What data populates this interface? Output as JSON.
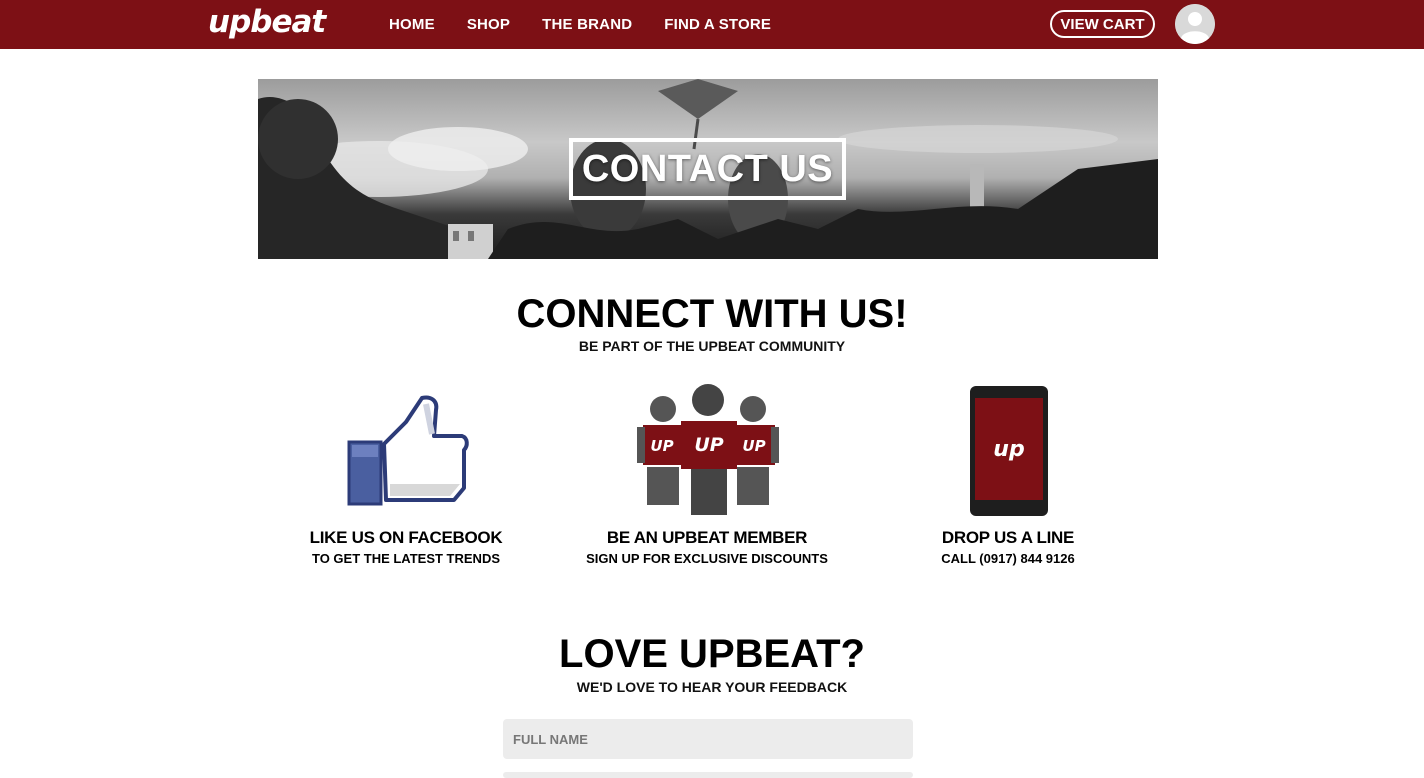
{
  "brand": {
    "logo_text": "upbeat",
    "accent_color": "#7d1015"
  },
  "nav": {
    "items": [
      "HOME",
      "SHOP",
      "THE BRAND",
      "FIND A STORE"
    ],
    "cart_label": "VIEW CART",
    "avatar_icon": "user-avatar-icon"
  },
  "hero": {
    "title": "CONTACT US"
  },
  "connect": {
    "title": "CONNECT WITH US!",
    "subtitle": "BE PART OF THE UPBEAT COMMUNITY",
    "cards": [
      {
        "icon": "thumbs-up-icon",
        "title": "LIKE US ON FACEBOOK",
        "subtitle": "TO GET THE LATEST TRENDS"
      },
      {
        "icon": "members-group-icon",
        "icon_text": "UP",
        "title": "BE AN UPBEAT MEMBER",
        "subtitle": "SIGN UP FOR EXCLUSIVE DISCOUNTS"
      },
      {
        "icon": "phone-icon",
        "icon_text": "up",
        "title": "DROP US A LINE",
        "subtitle": "CALL (0917) 844 9126"
      }
    ]
  },
  "feedback": {
    "title": "LOVE UPBEAT?",
    "subtitle": "WE'D LOVE TO HEAR YOUR FEEDBACK",
    "name_placeholder": "FULL NAME"
  }
}
